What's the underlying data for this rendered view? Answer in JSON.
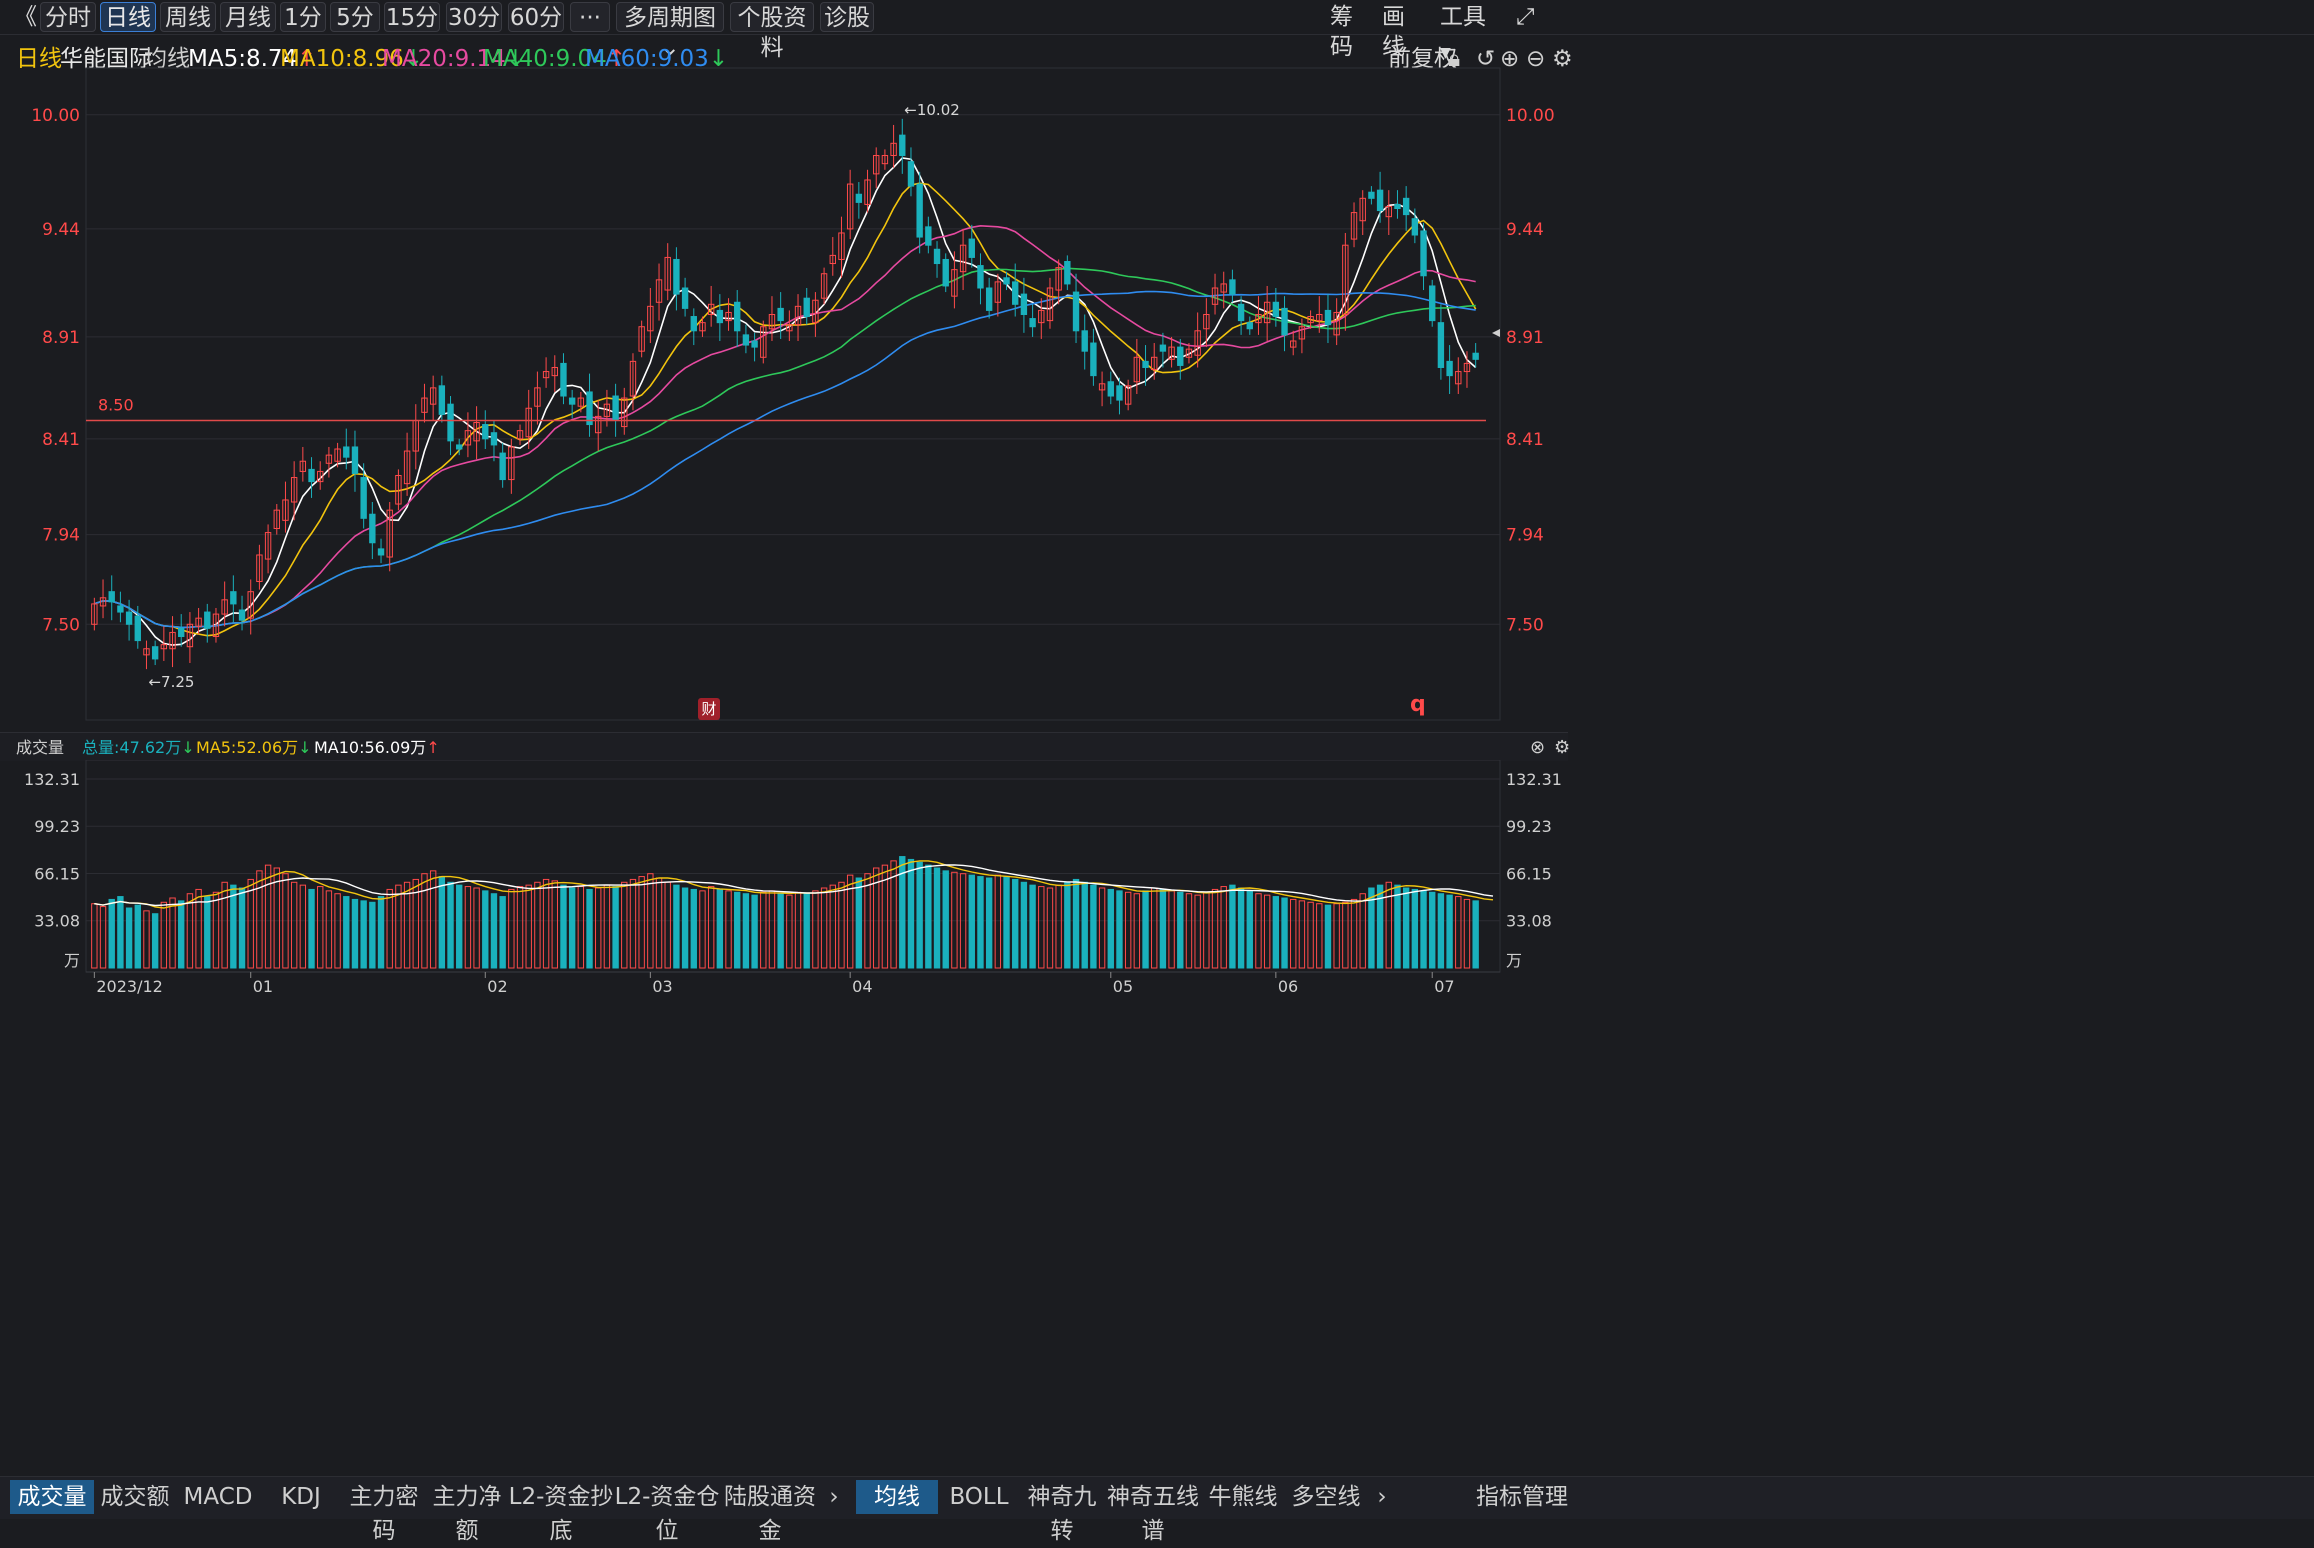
{
  "toolbar": {
    "back": "《",
    "tabs": [
      "分时",
      "日线",
      "周线",
      "月线",
      "1分",
      "5分",
      "15分",
      "30分",
      "60分",
      "···",
      "多周期图",
      "个股资料",
      "诊股"
    ],
    "active_tab": "日线",
    "right": [
      "筹码",
      "画线",
      "工具"
    ],
    "expand": "⤢"
  },
  "info": {
    "period": "日线",
    "stock_name": "华能国际",
    "ma_label": "均线",
    "ma5": "MA5:8.74",
    "ma10": "MA10:8.96",
    "ma20": "MA20:9.14",
    "ma40": "MA40:9.04",
    "ma60": "MA60:9.03",
    "adjust": "前复权"
  },
  "colors": {
    "up": "#ff4a4a",
    "down": "#1ab1bd",
    "ma5": "#ffffff",
    "ma10": "#f2c40e",
    "ma20": "#e64aa0",
    "ma40": "#2ec85a",
    "ma60": "#2f8cf0",
    "price_axis": "#ff4a4a",
    "ref_line": "#e04a4a"
  },
  "price_panel": {
    "price_ticks": [
      "10.00",
      "9.44",
      "8.91",
      "8.41",
      "7.94",
      "7.50"
    ],
    "high_annotation": "←10.02",
    "low_annotation": "←7.25",
    "ref_line_label": "8.50",
    "cai_badge": "财",
    "q_badge": "q"
  },
  "volume_panel": {
    "title": "成交量",
    "total": "总量:47.62万",
    "ma5": "MA5:52.06万",
    "ma10": "MA10:56.09万",
    "ticks": [
      "132.31",
      "99.23",
      "66.15",
      "33.08",
      "万"
    ]
  },
  "date_labels": [
    "2023/12",
    "01",
    "02",
    "03",
    "04",
    "05",
    "06",
    "07"
  ],
  "bottom_tabs_left": [
    "成交量",
    "成交额",
    "MACD",
    "KDJ",
    "主力密码",
    "主力净额",
    "L2-资金抄底",
    "L2-资金仓位",
    "陆股通资金"
  ],
  "bottom_tabs_right": [
    "均线",
    "BOLL",
    "神奇九转",
    "神奇五线谱",
    "牛熊线",
    "多空线"
  ],
  "bottom_right": "指标管理",
  "chart_data": {
    "type": "candlestick",
    "title": "华能国际 日线",
    "y_ticks": [
      10.0,
      9.44,
      8.91,
      8.41,
      7.94,
      7.5
    ],
    "ylim": [
      7.05,
      10.2
    ],
    "ref_line": 8.5,
    "annotations": [
      {
        "text": "10.02",
        "type": "high"
      },
      {
        "text": "7.25",
        "type": "low"
      }
    ],
    "months": [
      "2023/12",
      "01",
      "02",
      "03",
      "04",
      "05",
      "06",
      "07"
    ],
    "close": [
      7.6,
      7.63,
      7.61,
      7.56,
      7.5,
      7.42,
      7.38,
      7.33,
      7.4,
      7.46,
      7.44,
      7.5,
      7.53,
      7.48,
      7.55,
      7.62,
      7.6,
      7.52,
      7.66,
      7.84,
      7.95,
      8.06,
      8.11,
      8.22,
      8.3,
      8.2,
      8.25,
      8.33,
      8.36,
      8.32,
      8.24,
      8.02,
      7.9,
      7.84,
      8.06,
      8.23,
      8.35,
      8.5,
      8.61,
      8.66,
      8.53,
      8.4,
      8.36,
      8.45,
      8.49,
      8.41,
      8.38,
      8.21,
      8.37,
      8.45,
      8.56,
      8.66,
      8.74,
      8.76,
      8.62,
      8.58,
      8.61,
      8.48,
      8.52,
      8.58,
      8.5,
      8.61,
      8.79,
      8.96,
      9.06,
      9.19,
      9.3,
      9.12,
      9.05,
      8.94,
      8.98,
      9.07,
      8.98,
      9.03,
      8.94,
      8.87,
      8.86,
      8.96,
      9.02,
      8.99,
      8.97,
      9.06,
      9.01,
      9.09,
      9.22,
      9.31,
      9.42,
      9.66,
      9.57,
      9.68,
      9.8,
      9.8,
      9.86,
      9.8,
      9.65,
      9.4,
      9.36,
      9.27,
      9.16,
      9.24,
      9.36,
      9.3,
      9.15,
      9.04,
      9.18,
      9.17,
      9.07,
      9.02,
      8.96,
      9.04,
      9.15,
      9.25,
      9.17,
      8.94,
      8.84,
      8.72,
      8.68,
      8.62,
      8.6,
      8.67,
      8.81,
      8.76,
      8.81,
      8.84,
      8.86,
      8.77,
      8.85,
      8.94,
      9.02,
      9.15,
      9.17,
      9.12,
      8.99,
      8.95,
      9.02,
      9.08,
      9.01,
      8.92,
      8.89,
      8.96,
      9.01,
      9.02,
      8.97,
      9.03,
      9.36,
      9.52,
      9.59,
      9.59,
      9.53,
      9.55,
      9.54,
      9.51,
      9.41,
      9.21,
      8.99,
      8.76,
      8.72,
      8.74,
      8.78,
      8.8
    ],
    "volume": [
      45,
      43,
      48,
      50,
      42,
      44,
      40,
      38,
      46,
      49,
      47,
      52,
      55,
      50,
      53,
      60,
      58,
      56,
      62,
      68,
      72,
      70,
      66,
      60,
      58,
      55,
      57,
      54,
      52,
      50,
      48,
      47,
      46,
      50,
      55,
      58,
      60,
      62,
      66,
      68,
      64,
      60,
      58,
      57,
      56,
      54,
      52,
      50,
      55,
      57,
      58,
      60,
      62,
      61,
      58,
      56,
      57,
      55,
      56,
      58,
      57,
      60,
      62,
      64,
      66,
      63,
      60,
      58,
      56,
      55,
      54,
      57,
      55,
      54,
      53,
      52,
      51,
      53,
      54,
      52,
      51,
      53,
      52,
      54,
      56,
      58,
      60,
      65,
      63,
      66,
      70,
      72,
      75,
      78,
      76,
      74,
      72,
      70,
      68,
      67,
      66,
      65,
      64,
      63,
      65,
      64,
      62,
      60,
      58,
      57,
      56,
      58,
      60,
      62,
      60,
      58,
      56,
      55,
      54,
      53,
      52,
      54,
      56,
      55,
      54,
      53,
      52,
      51,
      53,
      55,
      57,
      58,
      56,
      54,
      52,
      51,
      50,
      49,
      48,
      47,
      46,
      45,
      44,
      45,
      46,
      48,
      52,
      56,
      58,
      60,
      58,
      56,
      55,
      54,
      53,
      52,
      51,
      50,
      48,
      47,
      46,
      47.62
    ],
    "vol_ticks": [
      132.31,
      99.23,
      66.15,
      33.08
    ],
    "vol_ylim": [
      0,
      140
    ],
    "vol_unit": "万"
  }
}
